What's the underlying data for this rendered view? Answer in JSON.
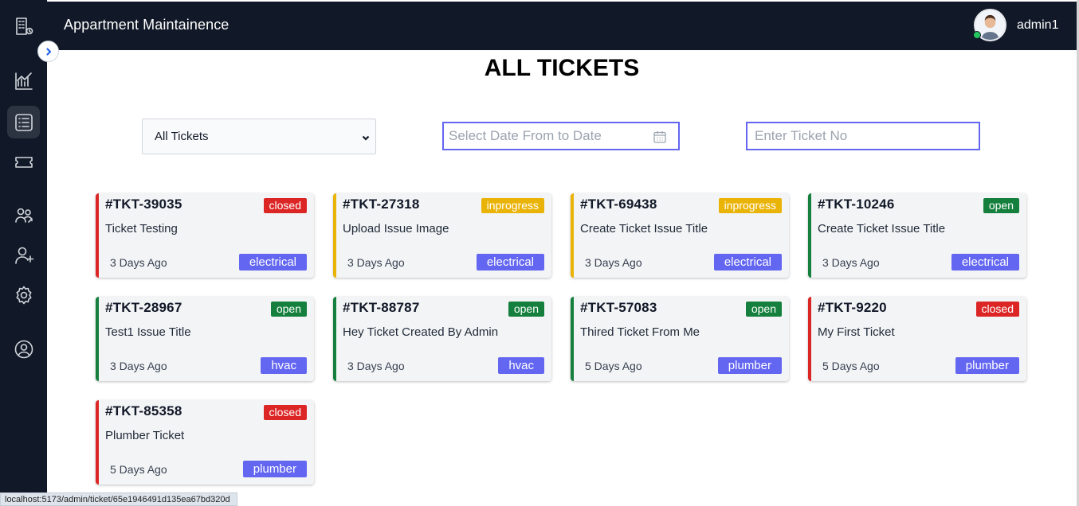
{
  "app": {
    "title": "Appartment Maintainence"
  },
  "user": {
    "name": "admin1"
  },
  "page": {
    "title": "ALL TICKETS"
  },
  "filters": {
    "ticket_type": {
      "selected": "All Tickets"
    },
    "date_range": {
      "placeholder": "Select Date From to Date"
    },
    "ticket_no": {
      "placeholder": "Enter Ticket No"
    }
  },
  "sidebar": {
    "items": [
      {
        "icon": "building-icon"
      },
      {
        "icon": "chart-icon"
      },
      {
        "icon": "list-icon",
        "active": true
      },
      {
        "icon": "ticket-icon"
      },
      {
        "icon": "users-icon"
      },
      {
        "icon": "add-user-icon"
      },
      {
        "icon": "gear-icon"
      },
      {
        "icon": "user-circle-icon"
      }
    ]
  },
  "colors": {
    "closed": "#dc2626",
    "inprogress": "#eab308",
    "open": "#15803d",
    "category": "#6366f1",
    "sidebar": "#111827"
  },
  "tickets": [
    {
      "id": "#TKT-39035",
      "status": "closed",
      "title": "Ticket Testing",
      "time": "3 Days Ago",
      "category": "electrical"
    },
    {
      "id": "#TKT-27318",
      "status": "inprogress",
      "title": "Upload Issue Image",
      "time": "3 Days Ago",
      "category": "electrical"
    },
    {
      "id": "#TKT-69438",
      "status": "inprogress",
      "title": "Create Ticket Issue Title",
      "time": "3 Days Ago",
      "category": "electrical"
    },
    {
      "id": "#TKT-10246",
      "status": "open",
      "title": "Create Ticket Issue Title",
      "time": "3 Days Ago",
      "category": "electrical"
    },
    {
      "id": "#TKT-28967",
      "status": "open",
      "title": "Test1 Issue Title",
      "time": "3 Days Ago",
      "category": "hvac"
    },
    {
      "id": "#TKT-88787",
      "status": "open",
      "title": "Hey Ticket Created By Admin",
      "time": "3 Days Ago",
      "category": "hvac"
    },
    {
      "id": "#TKT-57083",
      "status": "open",
      "title": "Thired Ticket From Me",
      "time": "5 Days Ago",
      "category": "plumber"
    },
    {
      "id": "#TKT-9220",
      "status": "closed",
      "title": "My First Ticket",
      "time": "5 Days Ago",
      "category": "plumber"
    },
    {
      "id": "#TKT-85358",
      "status": "closed",
      "title": "Plumber Ticket",
      "time": "5 Days Ago",
      "category": "plumber"
    }
  ],
  "statusbar": {
    "url": "localhost:5173/admin/ticket/65e1946491d135ea67bd320d"
  }
}
